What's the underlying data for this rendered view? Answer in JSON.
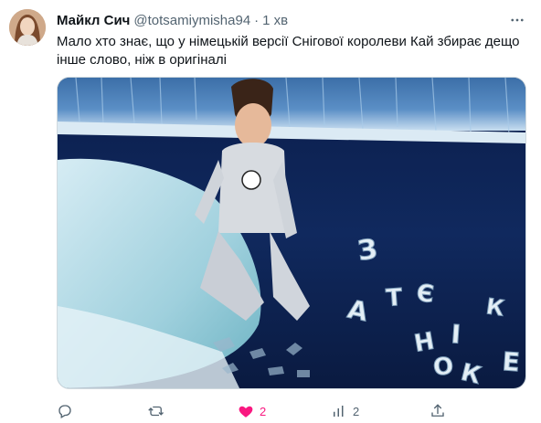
{
  "post": {
    "display_name": "Майкл Сич",
    "handle": "@totsamiymisha94",
    "separator": "·",
    "time": "1 хв",
    "text": "Мало хто знає, що у німецькій версії Снігової королеви Кай збирає дещо інше слово, ніж в оригіналі"
  },
  "media": {
    "letters": [
      "З",
      "А",
      "Т",
      "Є",
      "Н",
      "І",
      "К",
      "О",
      "Е",
      "К"
    ]
  },
  "actions": {
    "like_count": "2",
    "views_count": "2"
  },
  "icons": {
    "more": "more-horizontal-icon",
    "reply": "reply-icon",
    "repost": "repost-icon",
    "like": "heart-filled-icon",
    "views": "views-icon",
    "share": "share-icon"
  },
  "colors": {
    "like_active": "#f91880",
    "secondary_text": "#536471"
  }
}
